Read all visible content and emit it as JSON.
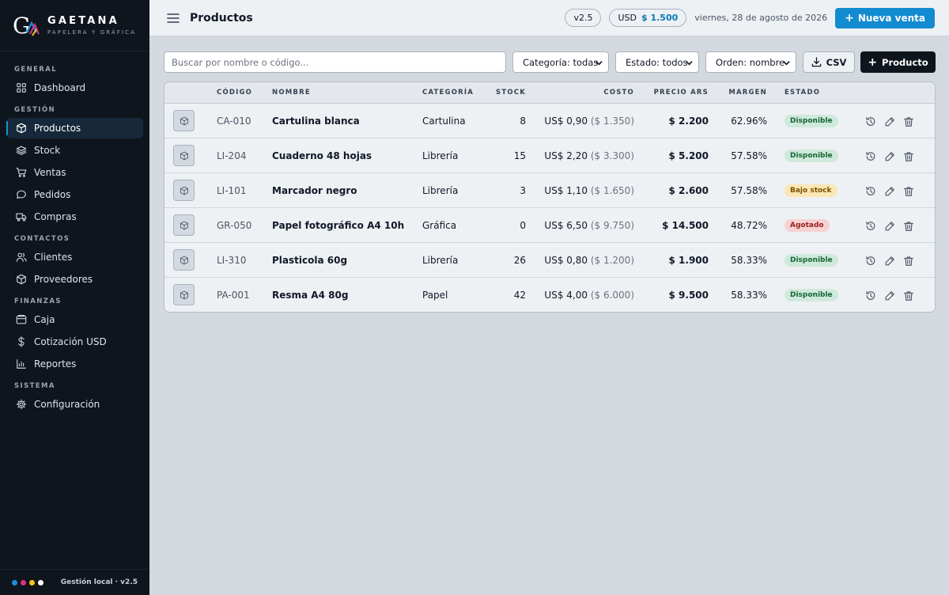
{
  "brand": {
    "name": "GAETANA",
    "tagline": "PAPELERA Y GRÁFICA",
    "logo_letter": "G"
  },
  "sidebar": {
    "sections": [
      {
        "title": "GENERAL",
        "items": [
          {
            "label": "Dashboard",
            "icon": "dashboard-icon"
          }
        ]
      },
      {
        "title": "GESTIÓN",
        "items": [
          {
            "label": "Productos",
            "icon": "box-icon",
            "active": true
          },
          {
            "label": "Stock",
            "icon": "layers-icon"
          },
          {
            "label": "Ventas",
            "icon": "cart-icon"
          },
          {
            "label": "Pedidos",
            "icon": "chat-icon"
          },
          {
            "label": "Compras",
            "icon": "truck-icon"
          }
        ]
      },
      {
        "title": "CONTACTOS",
        "items": [
          {
            "label": "Clientes",
            "icon": "users-icon"
          },
          {
            "label": "Proveedores",
            "icon": "box-icon"
          }
        ]
      },
      {
        "title": "FINANZAS",
        "items": [
          {
            "label": "Caja",
            "icon": "wallet-icon"
          },
          {
            "label": "Cotización USD",
            "icon": "dollar-icon"
          },
          {
            "label": "Reportes",
            "icon": "chart-icon"
          }
        ]
      },
      {
        "title": "SISTEMA",
        "items": [
          {
            "label": "Configuración",
            "icon": "gear-icon"
          }
        ]
      }
    ],
    "footer_text": "Gestión local · v2.5",
    "footer_dot_colors": [
      "#1a8fd8",
      "#d63384",
      "#f5c518",
      "#ffffff"
    ]
  },
  "header": {
    "title": "Productos",
    "version": "v2.5",
    "currency_label": "USD",
    "currency_rate": "$ 1.500",
    "date": "viernes, 28 de agosto de 2026",
    "new_sale": "Nueva venta"
  },
  "toolbar": {
    "search_placeholder": "Buscar por nombre o código...",
    "category_filter": "Categoría: todas",
    "status_filter": "Estado: todos",
    "order_filter": "Orden: nombre",
    "csv_label": "CSV",
    "add_product_label": "Producto"
  },
  "table": {
    "columns": [
      "CÓDIGO",
      "NOMBRE",
      "CATEGORÍA",
      "STOCK",
      "COSTO",
      "PRECIO ARS",
      "MARGEN",
      "ESTADO"
    ],
    "rows": [
      {
        "code": "CA-010",
        "name": "Cartulina blanca",
        "category": "Cartulina",
        "stock": "8",
        "cost_usd": "US$ 0,90",
        "cost_ars": "($ 1.350)",
        "price": "$ 2.200",
        "margin": "62.96%",
        "status": "Disponible"
      },
      {
        "code": "LI-204",
        "name": "Cuaderno 48 hojas",
        "category": "Librería",
        "stock": "15",
        "cost_usd": "US$ 2,20",
        "cost_ars": "($ 3.300)",
        "price": "$ 5.200",
        "margin": "57.58%",
        "status": "Disponible"
      },
      {
        "code": "LI-101",
        "name": "Marcador negro",
        "category": "Librería",
        "stock": "3",
        "cost_usd": "US$ 1,10",
        "cost_ars": "($ 1.650)",
        "price": "$ 2.600",
        "margin": "57.58%",
        "status": "Bajo stock"
      },
      {
        "code": "GR-050",
        "name": "Papel fotográfico A4 10h",
        "category": "Gráfica",
        "stock": "0",
        "cost_usd": "US$ 6,50",
        "cost_ars": "($ 9.750)",
        "price": "$ 14.500",
        "margin": "48.72%",
        "status": "Agotado"
      },
      {
        "code": "LI-310",
        "name": "Plasticola 60g",
        "category": "Librería",
        "stock": "26",
        "cost_usd": "US$ 0,80",
        "cost_ars": "($ 1.200)",
        "price": "$ 1.900",
        "margin": "58.33%",
        "status": "Disponible"
      },
      {
        "code": "PA-001",
        "name": "Resma A4 80g",
        "category": "Papel",
        "stock": "42",
        "cost_usd": "US$ 4,00",
        "cost_ars": "($ 6.000)",
        "price": "$ 9.500",
        "margin": "58.33%",
        "status": "Disponible"
      }
    ],
    "status_colors": {
      "Disponible": {
        "bg": "#cfe9dc",
        "fg": "#166534"
      },
      "Bajo stock": {
        "bg": "#fbe7b5",
        "fg": "#7a5200"
      },
      "Agotado": {
        "bg": "#f6d2d2",
        "fg": "#9b1c1c"
      }
    },
    "row_actions": [
      "history-icon",
      "edit-icon",
      "trash-icon"
    ]
  }
}
